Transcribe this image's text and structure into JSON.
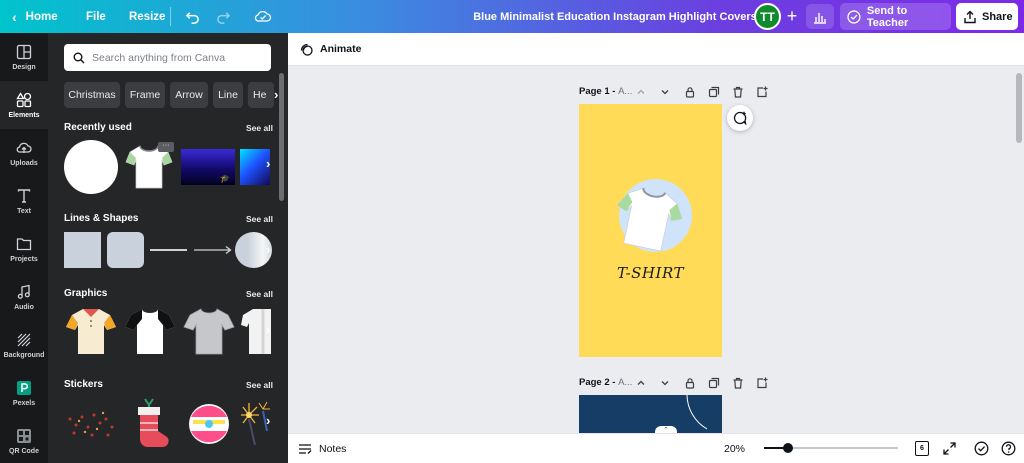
{
  "topbar": {
    "home_label": "Home",
    "file_label": "File",
    "resize_label": "Resize",
    "doc_title": "Blue Minimalist Education Instagram Highlight Covers",
    "avatar_initials": "TT",
    "avatar_color": "#0f8a2c",
    "send_label": "Send to Teacher",
    "share_label": "Share"
  },
  "rail": {
    "items": [
      {
        "label": "Design",
        "icon": "design-icon"
      },
      {
        "label": "Elements",
        "icon": "elements-icon"
      },
      {
        "label": "Uploads",
        "icon": "uploads-icon"
      },
      {
        "label": "Text",
        "icon": "text-icon"
      },
      {
        "label": "Projects",
        "icon": "projects-icon"
      },
      {
        "label": "Audio",
        "icon": "audio-icon"
      },
      {
        "label": "Background",
        "icon": "background-icon"
      },
      {
        "label": "Pexels",
        "icon": "pexels-icon"
      },
      {
        "label": "QR Code",
        "icon": "qr-code-icon"
      }
    ],
    "active_index": 1
  },
  "panel": {
    "search_placeholder": "Search anything from Canva",
    "chips": [
      "Christmas",
      "Frame",
      "Arrow",
      "Line",
      "He"
    ],
    "sections": {
      "recent": {
        "title": "Recently used",
        "see_all": "See all"
      },
      "lines": {
        "title": "Lines & Shapes",
        "see_all": "See all"
      },
      "graphics": {
        "title": "Graphics",
        "see_all": "See all"
      },
      "stickers": {
        "title": "Stickers",
        "see_all": "See all"
      }
    }
  },
  "editor": {
    "animate_label": "Animate",
    "page1_label": "Page 1 - ",
    "page1_suffix": "A...",
    "page2_label": "Page 2 - ",
    "page2_suffix": "A...",
    "page1_text": "T-SHIRT",
    "page1_bg": "#ffdb58",
    "page2_bg": "#163d66"
  },
  "bottombar": {
    "notes_label": "Notes",
    "zoom": "20%",
    "zoom_fraction": 0.18,
    "page_count": "6"
  }
}
